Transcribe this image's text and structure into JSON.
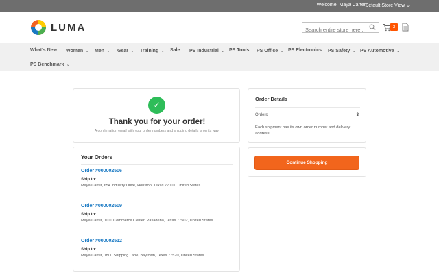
{
  "topbar": {
    "welcome": "Welcome, Maya Carter!",
    "store_view": "Default Store View"
  },
  "header": {
    "logo_text": "LUMA",
    "search_placeholder": "Search entire store here...",
    "cart_count": "3"
  },
  "nav": {
    "items": [
      {
        "label": "What's New",
        "dropdown": false
      },
      {
        "label": "Women",
        "dropdown": true
      },
      {
        "label": "Men",
        "dropdown": true
      },
      {
        "label": "Gear",
        "dropdown": true
      },
      {
        "label": "Training",
        "dropdown": true
      },
      {
        "label": "Sale",
        "dropdown": false
      },
      {
        "label": "PS Industrial",
        "dropdown": true
      },
      {
        "label": "PS Tools",
        "dropdown": false
      },
      {
        "label": "PS Office",
        "dropdown": true
      },
      {
        "label": "PS Electronics",
        "dropdown": false
      },
      {
        "label": "PS Safety",
        "dropdown": true
      },
      {
        "label": "PS Automotive",
        "dropdown": true
      },
      {
        "label": "PS Benchmark",
        "dropdown": true
      }
    ]
  },
  "thanks": {
    "title": "Thank you for your order!",
    "subtitle": "A confirmation email with your order numbers and shipping details is on its way."
  },
  "orders": {
    "title": "Your Orders",
    "ship_to_label": "Ship to:",
    "list": [
      {
        "number": "Order #000002506",
        "address": "Maya Carter, 654 Industry Drive, Houston, Texas 77001, United States"
      },
      {
        "number": "Order #000002509",
        "address": "Maya Carter, 1100 Commerce Center, Pasadena, Texas 77502, United States"
      },
      {
        "number": "Order #000002512",
        "address": "Maya Carter, 1800 Shipping Lane, Baytown, Texas 77520, United States"
      }
    ]
  },
  "details": {
    "title": "Order Details",
    "orders_label": "Orders",
    "orders_value": "3",
    "note": "Each shipment has its own order number and delivery address."
  },
  "cta": {
    "label": "Continue Shopping"
  },
  "colors": {
    "accent": "#1979c3",
    "cta": "#f2651c",
    "success": "#2ebd59",
    "cart_badge": "#ff5501"
  }
}
